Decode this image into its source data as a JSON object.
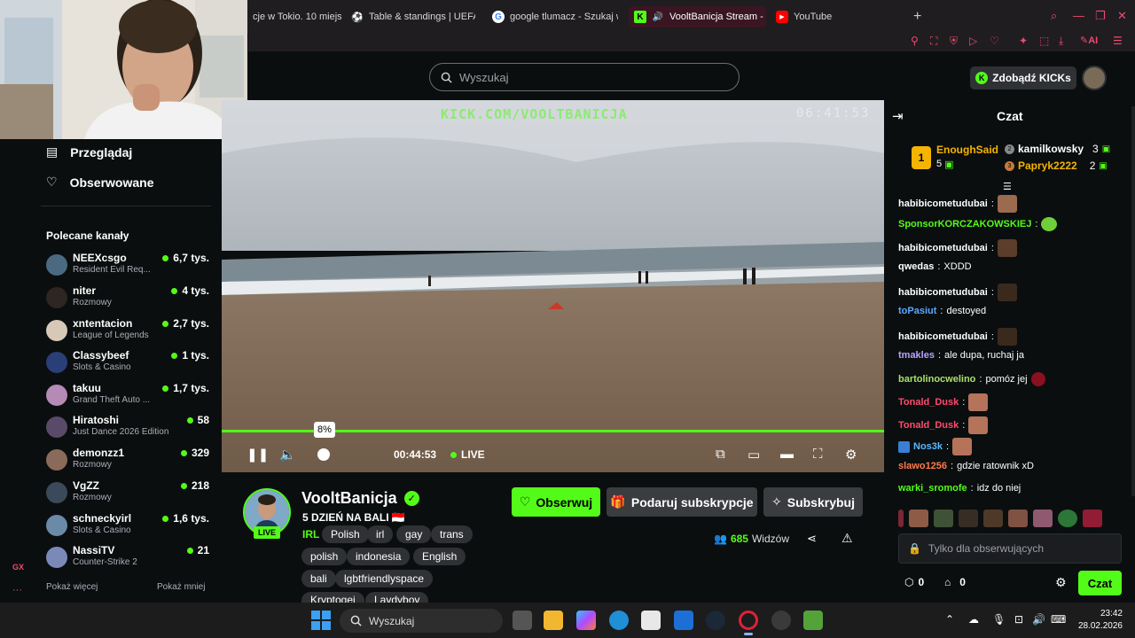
{
  "browser": {
    "tabs": [
      {
        "label": "cje w Tokio. 10 miejs",
        "icon": "page-icon"
      },
      {
        "label": "Table & standings | UEFA C",
        "icon": "soccer-ball-icon"
      },
      {
        "label": "google tlumacz - Szukaj w",
        "icon": "google-icon"
      },
      {
        "label": "VooltBanicja Stream -",
        "icon": "kick-icon",
        "active": true
      },
      {
        "label": "YouTube",
        "icon": "youtube-icon"
      }
    ],
    "ai_label": "AI"
  },
  "header": {
    "search_placeholder": "Wyszukaj",
    "kicks_label": "Zdobądź KICKs"
  },
  "sidebar": {
    "nav": [
      {
        "label": "Przeglądaj",
        "icon": "browse-icon"
      },
      {
        "label": "Obserwowane",
        "icon": "heart-icon"
      }
    ],
    "recommended_title": "Polecane kanały",
    "channels": [
      {
        "name": "NEEXcsgo",
        "category": "Resident Evil Req...",
        "viewers": "6,7 tys."
      },
      {
        "name": "niter",
        "category": "Rozmowy",
        "viewers": "4 tys."
      },
      {
        "name": "xntentacion",
        "category": "League of Legends",
        "viewers": "2,7 tys."
      },
      {
        "name": "Classybeef",
        "category": "Slots & Casino",
        "viewers": "1 tys."
      },
      {
        "name": "takuu",
        "category": "Grand Theft Auto ...",
        "viewers": "1,7 tys."
      },
      {
        "name": "Hiratoshi",
        "category": "Just Dance 2026 Edition",
        "viewers": "58"
      },
      {
        "name": "demonzz1",
        "category": "Rozmowy",
        "viewers": "329"
      },
      {
        "name": "VgZZ",
        "category": "Rozmowy",
        "viewers": "218"
      },
      {
        "name": "schneckyirl",
        "category": "Slots & Casino",
        "viewers": "1,6 tys."
      },
      {
        "name": "NassiTV",
        "category": "Counter-Strike 2",
        "viewers": "21"
      }
    ],
    "show_more": "Pokaż więcej",
    "show_less": "Pokaż mniej",
    "gx_label": "GX"
  },
  "video": {
    "overlay_url": "KICK.COM/VOOLTBANICJA",
    "overlay_time": "06:41:53",
    "volume_tooltip": "8%",
    "elapsed": "00:44:53",
    "live_label": "LIVE",
    "progress": 1.0,
    "volume": 0.08
  },
  "channel": {
    "name": "VooltBanicja",
    "title": "5 DZIEŃ NA BALI 🇮🇩",
    "live_badge": "LIVE",
    "category": "IRL",
    "tags": [
      "Polish",
      "irl",
      "gay",
      "trans",
      "polish",
      "indonesia",
      "English",
      "bali",
      "lgbtfriendlyspace",
      "Kryptogei",
      "Laydyboy"
    ],
    "follow_label": "Obserwuj",
    "gift_label": "Podaruj subskrypcje",
    "subscribe_label": "Subskrybuj",
    "viewers_count": "685",
    "viewers_label": "Widzów"
  },
  "chat": {
    "title": "Czat",
    "leaderboard": [
      {
        "rank": "1",
        "name": "EnoughSaid",
        "count": "5"
      },
      {
        "rank": "2",
        "name": "kamilkowsky",
        "count": "3"
      },
      {
        "rank": "3",
        "name": "Papryk2222",
        "count": "2"
      }
    ],
    "messages": [
      {
        "user": "habibicometudubai",
        "color": "#ffffff",
        "text": "",
        "emote": true
      },
      {
        "user": "SponsorKORCZAKOWSKIEJ",
        "color": "#53fc18",
        "text": "",
        "emote": true
      },
      {
        "user": "habibicometudubai",
        "color": "#ffffff",
        "text": "",
        "emote": true
      },
      {
        "user": "qwedas",
        "color": "#ffffff",
        "text": "XDDD",
        "emote": false
      },
      {
        "user": "habibicometudubai",
        "color": "#ffffff",
        "text": "",
        "emote": true
      },
      {
        "user": "toPasiut",
        "color": "#5aa8ff",
        "text": "destoyed",
        "emote": false
      },
      {
        "user": "habibicometudubai",
        "color": "#ffffff",
        "text": "",
        "emote": true
      },
      {
        "user": "tmakles",
        "color": "#b7a3ff",
        "text": "ale dupa, ruchaj ja",
        "emote": false
      },
      {
        "user": "bartolinocwelino",
        "color": "#a8e06a",
        "text": "pomóz jej",
        "emote": true
      },
      {
        "user": "Tonald_Dusk",
        "color": "#ff4b6e",
        "text": "",
        "emote": true
      },
      {
        "user": "Tonald_Dusk",
        "color": "#ff4b6e",
        "text": "",
        "emote": true
      },
      {
        "user": "Nos3k",
        "color": "#5ab8ff",
        "text": "",
        "emote": true
      },
      {
        "user": "slawo1256",
        "color": "#ff7a4b",
        "text": "gdzie ratownik xD",
        "emote": false
      },
      {
        "user": "warki_sromofe",
        "color": "#53fc18",
        "text": "idz do niej",
        "emote": false
      }
    ],
    "input_placeholder": "Tylko dla obserwujących",
    "points": "0",
    "drops": "0",
    "send_label": "Czat"
  },
  "taskbar": {
    "search_placeholder": "Wyszukaj",
    "time": "23:42",
    "date": "28.02.2026"
  },
  "colors": {
    "accent": "#53fc18",
    "tab_active": "#3a1622",
    "opera_red": "#f04a6e"
  }
}
